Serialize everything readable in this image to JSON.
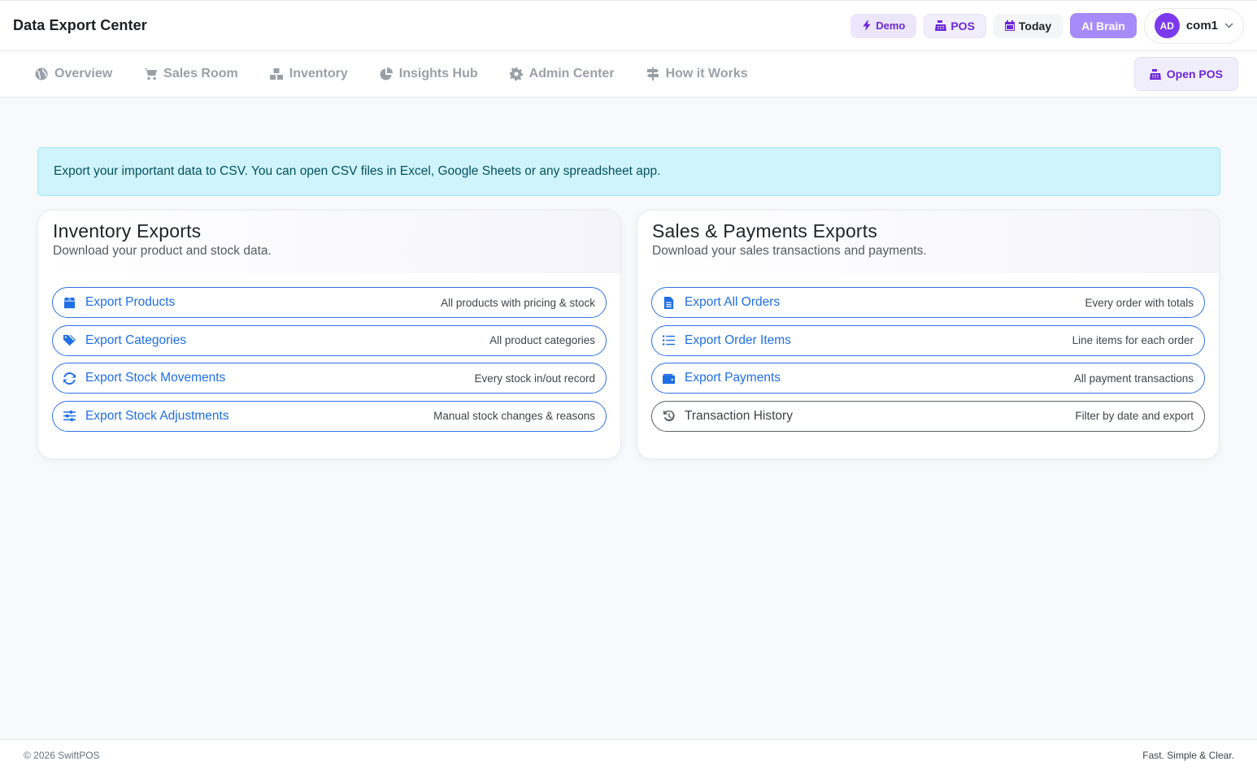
{
  "header": {
    "title": "Data Export Center",
    "demo_label": "Demo",
    "pos_label": "POS",
    "today_label": "Today",
    "ai_label": "AI Brain",
    "user": {
      "initials": "AD",
      "name": "com1"
    }
  },
  "nav": {
    "items": [
      {
        "label": "Overview",
        "icon": "globe-icon"
      },
      {
        "label": "Sales Room",
        "icon": "cart-icon"
      },
      {
        "label": "Inventory",
        "icon": "boxes-icon"
      },
      {
        "label": "Insights Hub",
        "icon": "pie-chart-icon"
      },
      {
        "label": "Admin Center",
        "icon": "gear-icon"
      },
      {
        "label": "How it Works",
        "icon": "signpost-icon"
      }
    ],
    "open_pos_label": "Open POS"
  },
  "alert": {
    "text": "Export your important data to CSV. You can open CSV files in Excel, Google Sheets or any spreadsheet app."
  },
  "inventory_card": {
    "title": "Inventory Exports",
    "subtitle": "Download your product and stock data.",
    "rows": [
      {
        "label": "Export Products",
        "desc": "All products with pricing & stock",
        "icon": "box-icon"
      },
      {
        "label": "Export Categories",
        "desc": "All product categories",
        "icon": "tags-icon"
      },
      {
        "label": "Export Stock Movements",
        "desc": "Every stock in/out record",
        "icon": "sync-icon"
      },
      {
        "label": "Export Stock Adjustments",
        "desc": "Manual stock changes & reasons",
        "icon": "sliders-icon"
      }
    ]
  },
  "sales_card": {
    "title": "Sales & Payments Exports",
    "subtitle": "Download your sales transactions and payments.",
    "rows": [
      {
        "label": "Export All Orders",
        "desc": "Every order with totals",
        "icon": "file-icon"
      },
      {
        "label": "Export Order Items",
        "desc": "Line items for each order",
        "icon": "list-icon"
      },
      {
        "label": "Export Payments",
        "desc": "All payment transactions",
        "icon": "wallet-icon"
      },
      {
        "label": "Transaction History",
        "desc": "Filter by date and export",
        "icon": "history-icon"
      }
    ]
  },
  "footer": {
    "left": "© 2026 SwiftPOS",
    "right": "Fast. Simple & Clear."
  },
  "colors": {
    "accent": "#7c3aed",
    "link_blue": "#1f6fe5",
    "alert_bg": "#cff4fc"
  }
}
